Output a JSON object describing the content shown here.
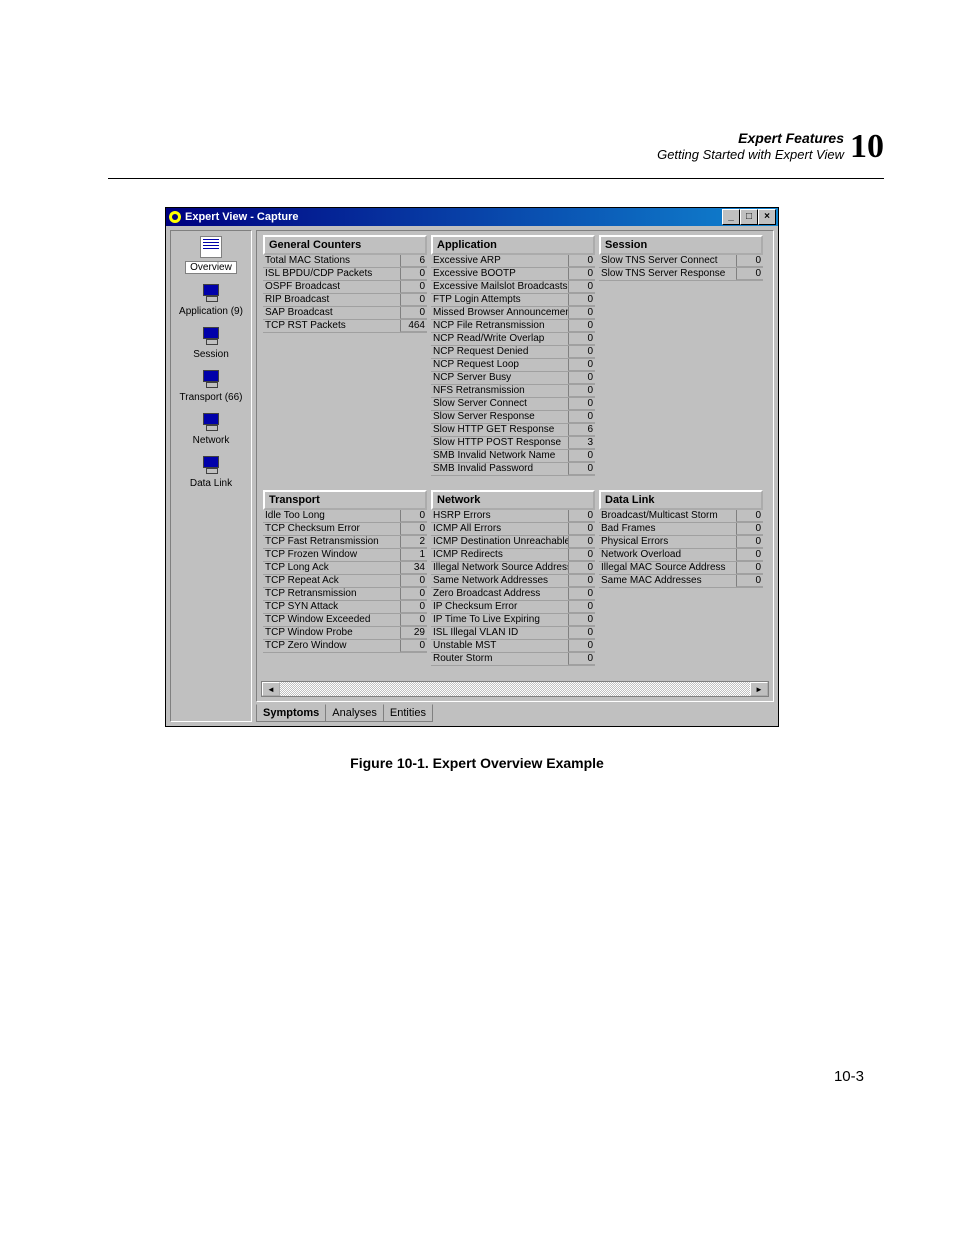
{
  "header": {
    "title": "Expert Features",
    "subtitle": "Getting Started with Expert View",
    "chapter": "10"
  },
  "page_number": "10-3",
  "figure_caption": "Figure 10-1.  Expert Overview Example",
  "window": {
    "title": "Expert View - Capture"
  },
  "sidebar": [
    {
      "label": "Overview"
    },
    {
      "label": "Application (9)"
    },
    {
      "label": "Session"
    },
    {
      "label": "Transport (66)"
    },
    {
      "label": "Network"
    },
    {
      "label": "Data Link"
    }
  ],
  "tabs": [
    {
      "label": "Symptoms",
      "active": true
    },
    {
      "label": "Analyses",
      "active": false
    },
    {
      "label": "Entities",
      "active": false
    }
  ],
  "panels_top": [
    {
      "title": "General Counters",
      "rows": [
        [
          "Total MAC Stations",
          6
        ],
        [
          "ISL BPDU/CDP Packets",
          0
        ],
        [
          "OSPF Broadcast",
          0
        ],
        [
          "RIP Broadcast",
          0
        ],
        [
          "SAP Broadcast",
          0
        ],
        [
          "TCP RST Packets",
          464
        ]
      ]
    },
    {
      "title": "Application",
      "rows": [
        [
          "Excessive ARP",
          0
        ],
        [
          "Excessive BOOTP",
          0
        ],
        [
          "Excessive Mailslot Broadcasts",
          0
        ],
        [
          "FTP Login Attempts",
          0
        ],
        [
          "Missed Browser Announcement",
          0
        ],
        [
          "NCP File Retransmission",
          0
        ],
        [
          "NCP Read/Write Overlap",
          0
        ],
        [
          "NCP Request Denied",
          0
        ],
        [
          "NCP Request Loop",
          0
        ],
        [
          "NCP Server Busy",
          0
        ],
        [
          "NFS Retransmission",
          0
        ],
        [
          "Slow Server Connect",
          0
        ],
        [
          "Slow Server Response",
          0
        ],
        [
          "Slow HTTP GET Response",
          6
        ],
        [
          "Slow HTTP POST Response",
          3
        ],
        [
          "SMB Invalid Network Name",
          0
        ],
        [
          "SMB Invalid Password",
          0
        ]
      ]
    },
    {
      "title": "Session",
      "rows": [
        [
          "Slow TNS Server Connect",
          0
        ],
        [
          "Slow TNS Server Response",
          0
        ]
      ]
    }
  ],
  "panels_bottom": [
    {
      "title": "Transport",
      "rows": [
        [
          "Idle Too Long",
          0
        ],
        [
          "TCP Checksum Error",
          0
        ],
        [
          "TCP Fast Retransmission",
          2
        ],
        [
          "TCP Frozen Window",
          1
        ],
        [
          "TCP Long Ack",
          34
        ],
        [
          "TCP Repeat Ack",
          0
        ],
        [
          "TCP Retransmission",
          0
        ],
        [
          "TCP SYN Attack",
          0
        ],
        [
          "TCP Window Exceeded",
          0
        ],
        [
          "TCP Window Probe",
          29
        ],
        [
          "TCP Zero Window",
          0
        ]
      ]
    },
    {
      "title": "Network",
      "rows": [
        [
          "HSRP Errors",
          0
        ],
        [
          "ICMP All Errors",
          0
        ],
        [
          "ICMP Destination Unreachable",
          0
        ],
        [
          "ICMP Redirects",
          0
        ],
        [
          "Illegal Network Source Address",
          0
        ],
        [
          "Same Network Addresses",
          0
        ],
        [
          "Zero Broadcast Address",
          0
        ],
        [
          "IP Checksum Error",
          0
        ],
        [
          "IP Time To Live Expiring",
          0
        ],
        [
          "ISL Illegal VLAN ID",
          0
        ],
        [
          "Unstable MST",
          0
        ],
        [
          "Router Storm",
          0
        ]
      ]
    },
    {
      "title": "Data Link",
      "rows": [
        [
          "Broadcast/Multicast Storm",
          0
        ],
        [
          "Bad Frames",
          0
        ],
        [
          "Physical Errors",
          0
        ],
        [
          "Network Overload",
          0
        ],
        [
          "Illegal MAC Source Address",
          0
        ],
        [
          "Same MAC Addresses",
          0
        ]
      ]
    }
  ]
}
